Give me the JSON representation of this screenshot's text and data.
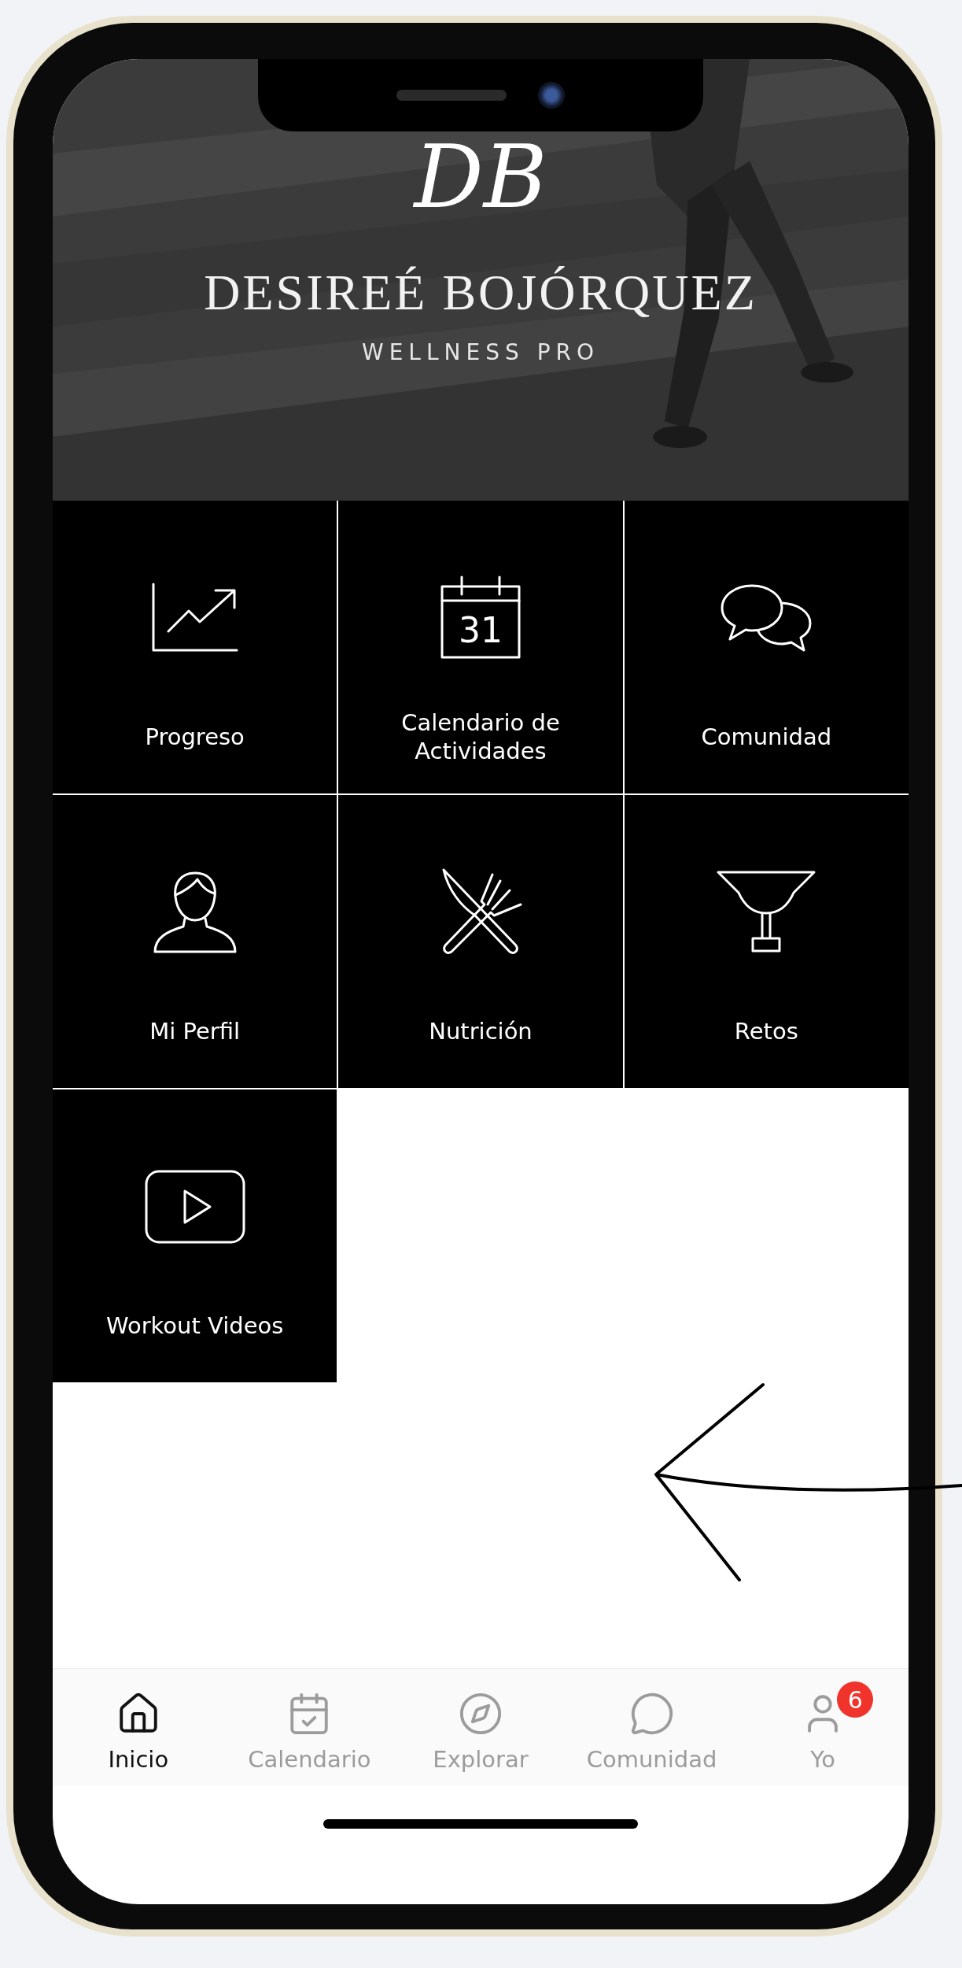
{
  "header": {
    "logo": "DB",
    "title": "DESIREÉ BOJÓRQUEZ",
    "subtitle": "WELLNESS PRO"
  },
  "tiles": [
    {
      "kind": "progress",
      "label": "Progreso"
    },
    {
      "kind": "calendar",
      "label": "Calendario de Actividades",
      "day": "31"
    },
    {
      "kind": "community",
      "label": "Comunidad"
    },
    {
      "kind": "profile",
      "label": "Mi Perfil"
    },
    {
      "kind": "nutrition",
      "label": "Nutrición"
    },
    {
      "kind": "challenges",
      "label": "Retos"
    },
    {
      "kind": "videos",
      "label": "Workout Videos"
    }
  ],
  "tab_bar": [
    {
      "kind": "home",
      "label": "Inicio",
      "selected": true
    },
    {
      "kind": "calendar",
      "label": "Calendario",
      "selected": false
    },
    {
      "kind": "explore",
      "label": "Explorar",
      "selected": false
    },
    {
      "kind": "community",
      "label": "Comunidad",
      "selected": false
    },
    {
      "kind": "profile",
      "label": "Yo",
      "selected": false,
      "badge": "6"
    }
  ]
}
